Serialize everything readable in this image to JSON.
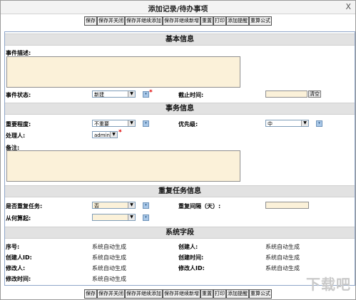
{
  "window": {
    "title": "添加记录/待办事项",
    "close": "X"
  },
  "toolbar": {
    "buttons": [
      "保存",
      "保存并关闭",
      "保存并继续添加",
      "保存并继续新增",
      "重置",
      "打印",
      "添加提醒",
      "重算公式"
    ]
  },
  "sections": {
    "basic": "基本信息",
    "task": "事务信息",
    "repeat": "重复任务信息",
    "system": "系统字段"
  },
  "basic": {
    "desc_label": "事件描述:",
    "status_label": "事件状态:",
    "status_value": "新建",
    "deadline_label": "截止时间:",
    "clear_button": "清空"
  },
  "task": {
    "importance_label": "重要程度:",
    "importance_value": "不重要",
    "priority_label": "优先级:",
    "priority_value": "中",
    "handler_label": "处理人:",
    "handler_value": "admin",
    "note_label": "备注:"
  },
  "repeat": {
    "is_repeat_label": "是否重复任务:",
    "is_repeat_value": "否",
    "interval_label": "重复间隔（天）:",
    "from_label": "从何算起:"
  },
  "system": {
    "seq_label": "序号:",
    "seq_value": "系统自动生成",
    "creator_label": "创建人:",
    "creator_value": "系统自动生成",
    "creator_id_label": "创建人ID:",
    "creator_id_value": "系统自动生成",
    "created_time_label": "创建时间:",
    "created_time_value": "系统自动生成",
    "modifier_label": "修改人:",
    "modifier_value": "系统自动生成",
    "modifier_id_label": "修改人ID:",
    "modifier_id_value": "系统自动生成",
    "modified_time_label": "修改时间:",
    "modified_time_value": "系统自动生成"
  },
  "watermark": "下载吧"
}
